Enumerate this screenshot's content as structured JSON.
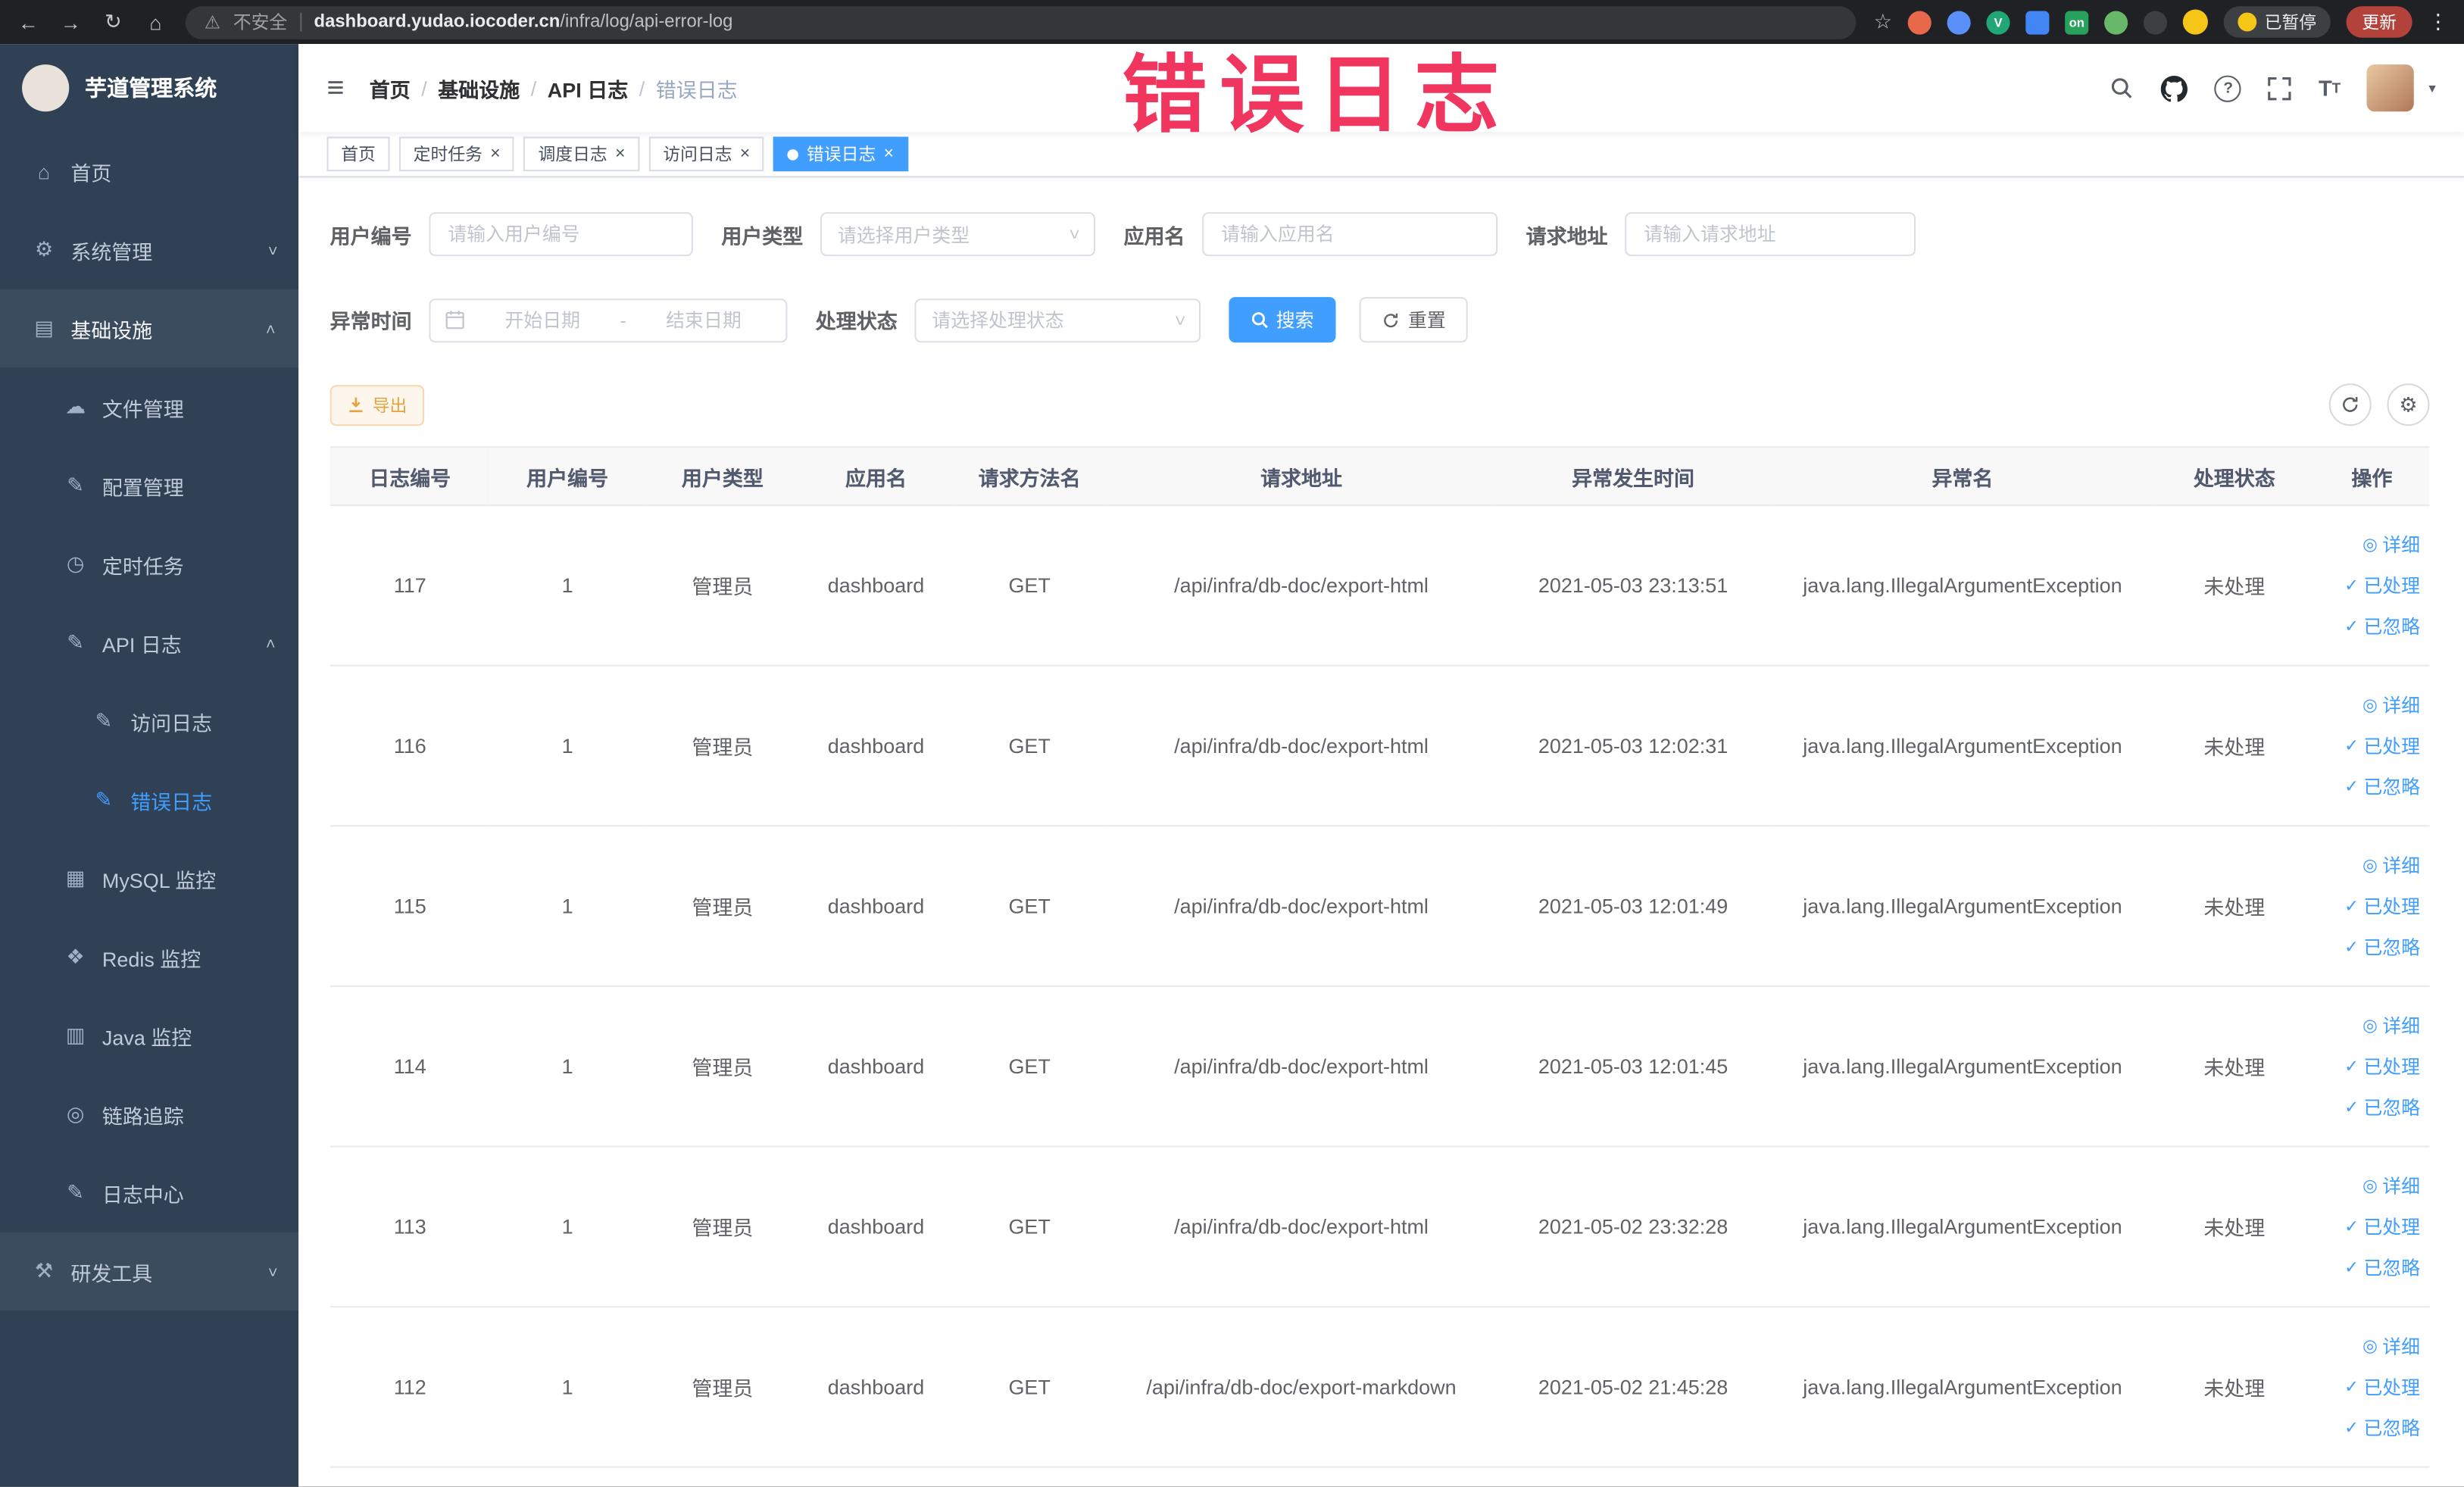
{
  "browser": {
    "security_label": "不安全",
    "url_domain": "dashboard.yudao.iocoder.cn",
    "url_path": "/infra/log/api-error-log",
    "paused_label": "已暂停",
    "update_label": "更新",
    "extensions": [
      {
        "name": "extension-adblock-icon",
        "color": "#e8684a",
        "text": "",
        "shape": "circle"
      },
      {
        "name": "extension-drop-icon",
        "color": "#5b8ff9",
        "text": "",
        "shape": "circle"
      },
      {
        "name": "extension-v-icon",
        "color": "#21a675",
        "text": "V",
        "shape": "circle"
      },
      {
        "name": "extension-grid-icon",
        "color": "#4285f4",
        "text": "",
        "shape": "square"
      },
      {
        "name": "extension-on-icon",
        "color": "#27a25c",
        "text": "on",
        "shape": "square"
      },
      {
        "name": "extension-leaf-icon",
        "color": "#67b868",
        "text": "",
        "shape": "circle"
      },
      {
        "name": "extension-dark-icon",
        "color": "#3c4043",
        "text": "",
        "shape": "circle"
      }
    ]
  },
  "annotation": {
    "text": "错误日志",
    "color": "#f0355f"
  },
  "sidebar": {
    "title": "芋道管理系统",
    "items": [
      {
        "key": "home",
        "label": "首页",
        "icon": "home-icon",
        "type": "item"
      },
      {
        "key": "system",
        "label": "系统管理",
        "icon": "gear-icon",
        "type": "group",
        "state": "collapsed"
      },
      {
        "key": "infra",
        "label": "基础设施",
        "icon": "infrastructure-icon",
        "type": "group",
        "state": "expanded",
        "highlight": true,
        "open": true
      },
      {
        "key": "file",
        "label": "文件管理",
        "icon": "file-icon",
        "type": "sub"
      },
      {
        "key": "config",
        "label": "配置管理",
        "icon": "config-icon",
        "type": "sub"
      },
      {
        "key": "job",
        "label": "定时任务",
        "icon": "timer-icon",
        "type": "sub"
      },
      {
        "key": "api-log",
        "label": "API 日志",
        "icon": "api-log-icon",
        "type": "subgroup",
        "state": "expanded"
      },
      {
        "key": "access-log",
        "label": "访问日志",
        "icon": "access-log-icon",
        "type": "sub2"
      },
      {
        "key": "error-log",
        "label": "错误日志",
        "icon": "error-log-icon",
        "type": "sub2",
        "active": true
      },
      {
        "key": "mysql",
        "label": "MySQL 监控",
        "icon": "mysql-icon",
        "type": "sub"
      },
      {
        "key": "redis",
        "label": "Redis 监控",
        "icon": "redis-icon",
        "type": "sub"
      },
      {
        "key": "java",
        "label": "Java 监控",
        "icon": "java-icon",
        "type": "sub"
      },
      {
        "key": "trace",
        "label": "链路追踪",
        "icon": "trace-icon",
        "type": "sub"
      },
      {
        "key": "log-center",
        "label": "日志中心",
        "icon": "log-center-icon",
        "type": "sub"
      },
      {
        "key": "devtools",
        "label": "研发工具",
        "icon": "devtools-icon",
        "type": "group",
        "state": "collapsed",
        "highlight": true
      }
    ]
  },
  "header": {
    "breadcrumb": [
      {
        "label": "首页"
      },
      {
        "label": "基础设施"
      },
      {
        "label": "API 日志"
      },
      {
        "label": "错误日志"
      }
    ]
  },
  "tabs": [
    {
      "key": "home",
      "label": "首页",
      "closable": false,
      "active": false
    },
    {
      "key": "job",
      "label": "定时任务",
      "closable": true,
      "active": false
    },
    {
      "key": "job-log",
      "label": "调度日志",
      "closable": true,
      "active": false
    },
    {
      "key": "access-log",
      "label": "访问日志",
      "closable": true,
      "active": false
    },
    {
      "key": "error-log",
      "label": "错误日志",
      "closable": true,
      "active": true
    }
  ],
  "filters": {
    "user_id_label": "用户编号",
    "user_id_placeholder": "请输入用户编号",
    "user_type_label": "用户类型",
    "user_type_placeholder": "请选择用户类型",
    "app_name_label": "应用名",
    "app_name_placeholder": "请输入应用名",
    "request_url_label": "请求地址",
    "request_url_placeholder": "请输入请求地址",
    "exception_time_label": "异常时间",
    "start_date_placeholder": "开始日期",
    "range_separator": "-",
    "end_date_placeholder": "结束日期",
    "process_status_label": "处理状态",
    "process_status_placeholder": "请选择处理状态",
    "search_label": "搜索",
    "reset_label": "重置"
  },
  "toolbar": {
    "export_label": "导出"
  },
  "table": {
    "columns": [
      "日志编号",
      "用户编号",
      "用户类型",
      "应用名",
      "请求方法名",
      "请求地址",
      "异常发生时间",
      "异常名",
      "处理状态",
      "操作"
    ],
    "action_labels": {
      "detail": "详细",
      "processed": "已处理",
      "ignored": "已忽略"
    },
    "rows": [
      {
        "id": "117",
        "user_id": "1",
        "user_type": "管理员",
        "app": "dashboard",
        "method": "GET",
        "url": "/api/infra/db-doc/export-html",
        "time": "2021-05-03 23:13:51",
        "exception": "java.lang.IllegalArgumentException",
        "status": "未处理"
      },
      {
        "id": "116",
        "user_id": "1",
        "user_type": "管理员",
        "app": "dashboard",
        "method": "GET",
        "url": "/api/infra/db-doc/export-html",
        "time": "2021-05-03 12:02:31",
        "exception": "java.lang.IllegalArgumentException",
        "status": "未处理"
      },
      {
        "id": "115",
        "user_id": "1",
        "user_type": "管理员",
        "app": "dashboard",
        "method": "GET",
        "url": "/api/infra/db-doc/export-html",
        "time": "2021-05-03 12:01:49",
        "exception": "java.lang.IllegalArgumentException",
        "status": "未处理"
      },
      {
        "id": "114",
        "user_id": "1",
        "user_type": "管理员",
        "app": "dashboard",
        "method": "GET",
        "url": "/api/infra/db-doc/export-html",
        "time": "2021-05-03 12:01:45",
        "exception": "java.lang.IllegalArgumentException",
        "status": "未处理"
      },
      {
        "id": "113",
        "user_id": "1",
        "user_type": "管理员",
        "app": "dashboard",
        "method": "GET",
        "url": "/api/infra/db-doc/export-html",
        "time": "2021-05-02 23:32:28",
        "exception": "java.lang.IllegalArgumentException",
        "status": "未处理"
      },
      {
        "id": "112",
        "user_id": "1",
        "user_type": "管理员",
        "app": "dashboard",
        "method": "GET",
        "url": "/api/infra/db-doc/export-markdown",
        "time": "2021-05-02 21:45:28",
        "exception": "java.lang.IllegalArgumentException",
        "status": "未处理"
      }
    ]
  }
}
